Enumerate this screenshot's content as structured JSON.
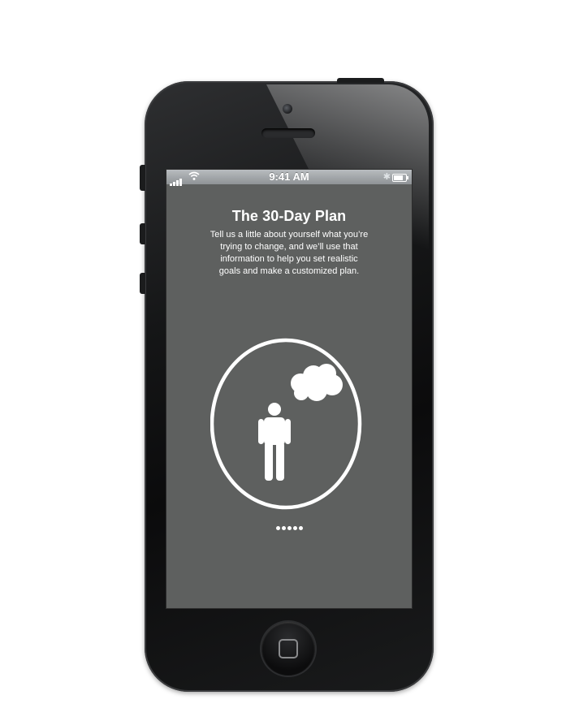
{
  "status_bar": {
    "time": "9:41 AM",
    "signal_bars": 4,
    "battery_level": 0.8
  },
  "screen": {
    "title": "The 30-Day Plan",
    "description": "Tell us a little about yourself what you’re trying to change, and we’ll use that information to help you set realistic goals and make a customized plan."
  },
  "page_indicator": {
    "count": 5,
    "current": 1
  },
  "colors": {
    "screen_background": "#5e605f",
    "text": "#ffffff",
    "phone_body": "#151617"
  },
  "icons": {
    "illustration": "person-thinking-icon",
    "thought": "thought-bubble-icon"
  }
}
